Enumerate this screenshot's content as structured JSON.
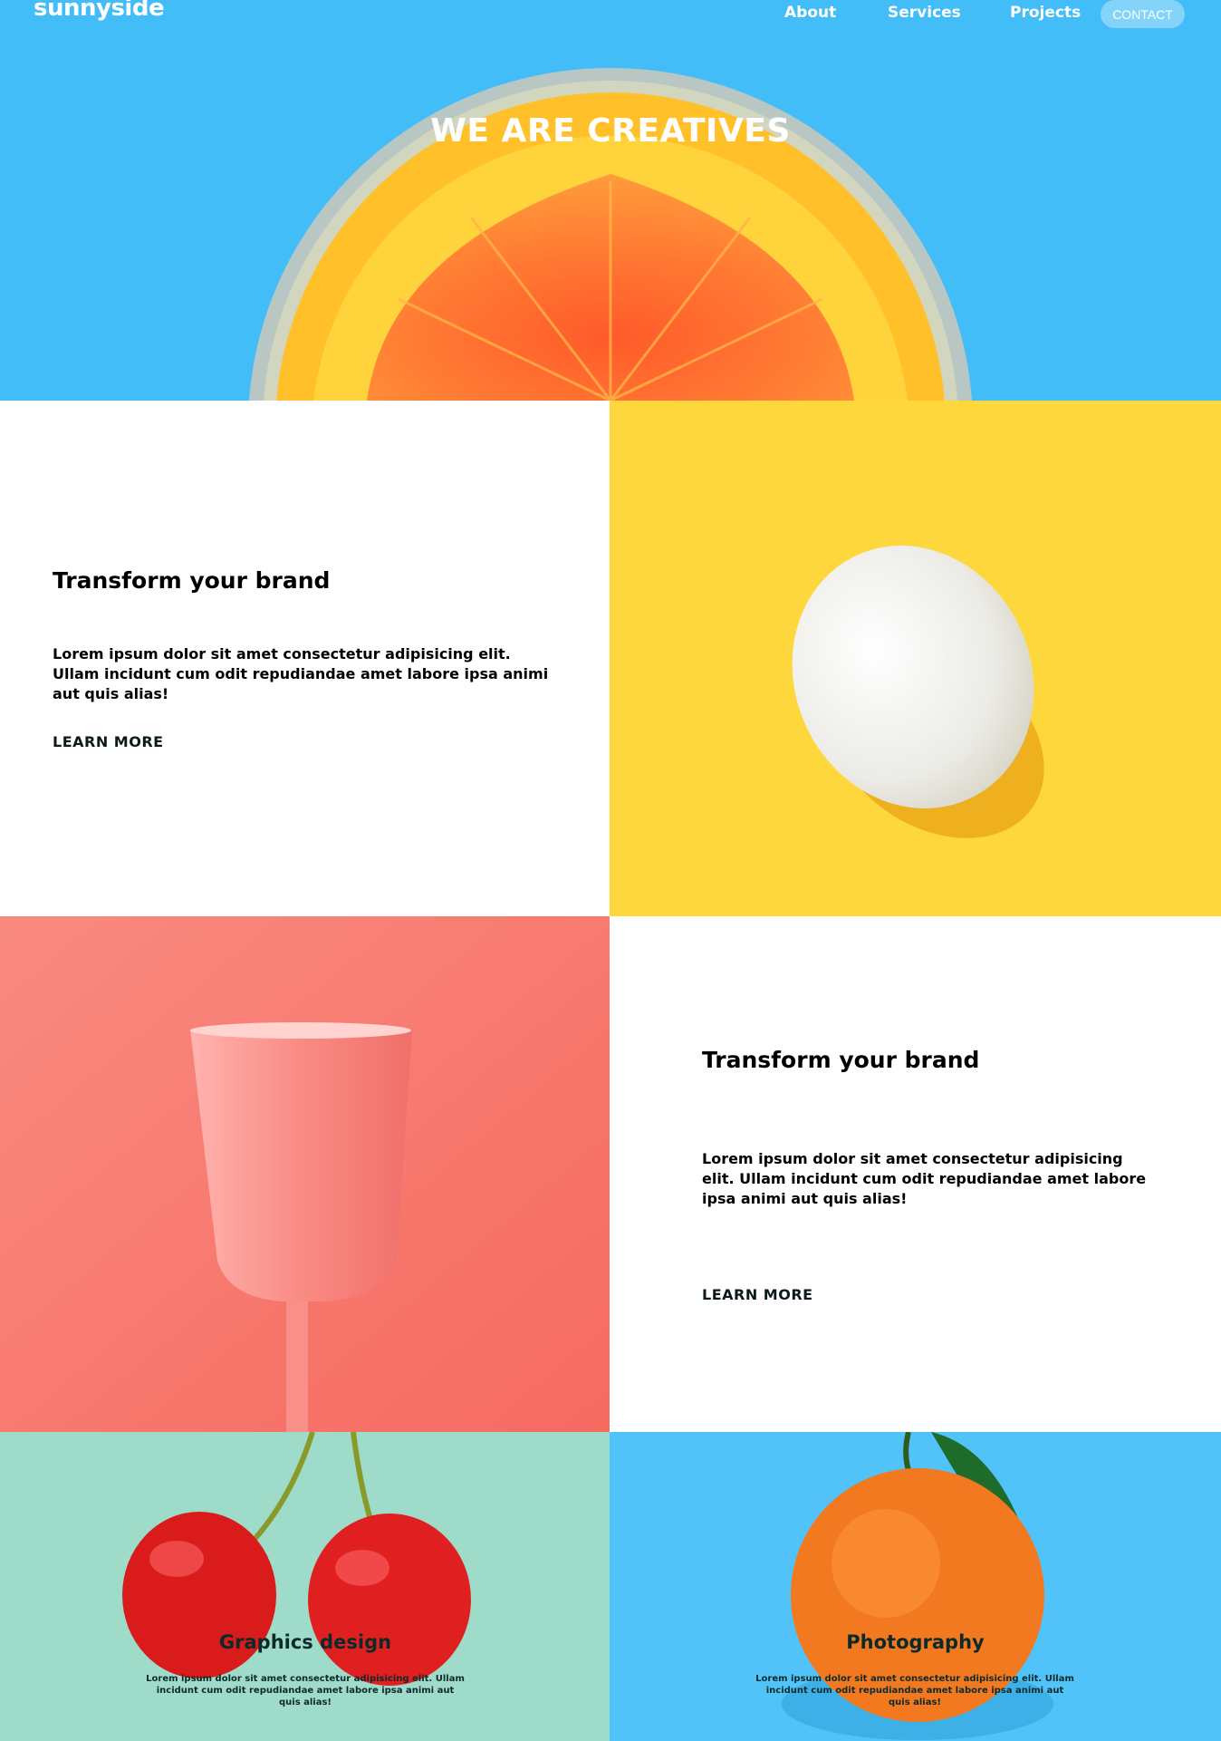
{
  "header": {
    "logo": "sunnyside",
    "nav": {
      "about": "About",
      "services": "Services",
      "projects": "Projects",
      "contact": "CONTACT"
    },
    "hero_title": "WE ARE CREATIVES"
  },
  "section_one": {
    "title": "Transform your brand",
    "body": "Lorem ipsum dolor sit amet consectetur adipisicing elit. Ullam incidunt cum odit repudiandae amet labore ipsa animi aut quis alias!",
    "link": "LEARN MORE"
  },
  "section_two": {
    "title": "Transform your brand",
    "body": "Lorem ipsum dolor sit amet consectetur adipisicing elit. Ullam incidunt cum odit repudiandae amet labore ipsa animi aut quis alias!",
    "link": "LEARN MORE"
  },
  "services": [
    {
      "title": "Graphics design",
      "body": "Lorem ipsum dolor sit amet consectetur adipisicing elit. Ullam incidunt cum odit repudiandae amet labore ipsa animi aut quis alias!"
    },
    {
      "title": "Photography",
      "body": "Lorem ipsum dolor sit amet consectetur adipisicing elit. Ullam incidunt cum odit repudiandae amet labore ipsa animi aut quis alias!"
    }
  ],
  "colors": {
    "hero_blue": "#43bdf8",
    "egg_yellow": "#fdd73c",
    "glass_coral": "#f9726b",
    "cherry_mint": "#9edbc9",
    "orange_blue": "#51c3f8"
  }
}
